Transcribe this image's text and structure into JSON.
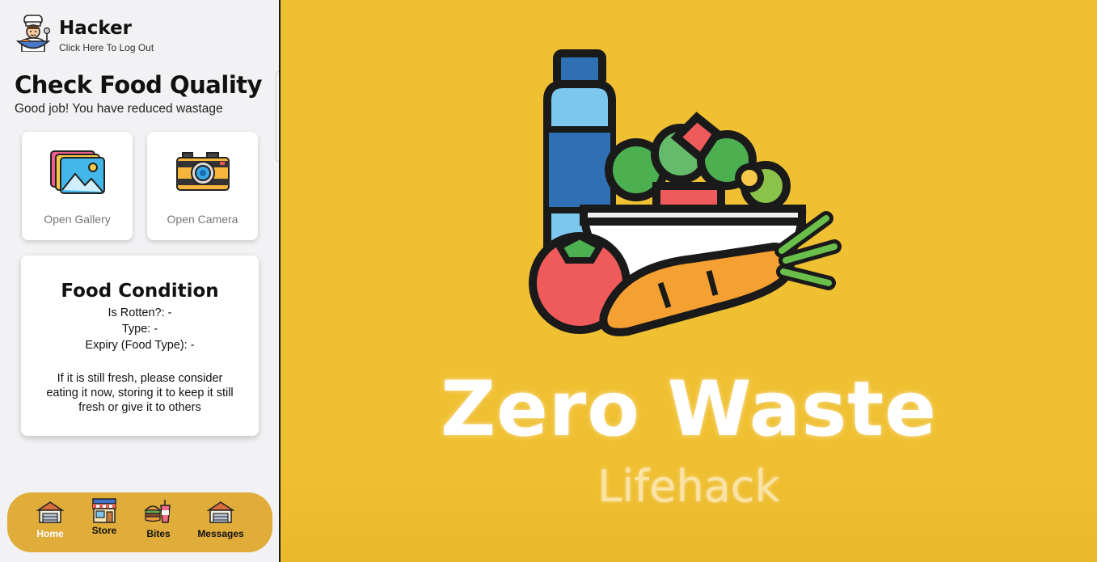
{
  "header": {
    "user_name": "Hacker",
    "logout_label": "Click Here To Log Out",
    "avatar_icon": "chef-avatar-icon"
  },
  "page": {
    "title": "Check Food Quality",
    "subtitle": "Good job! You have reduced wastage"
  },
  "actions": [
    {
      "label": "Open Gallery",
      "icon": "gallery-icon"
    },
    {
      "label": "Open Camera",
      "icon": "camera-icon"
    }
  ],
  "condition": {
    "title": "Food Condition",
    "rotten_label": "Is Rotten?:",
    "rotten_value": "-",
    "type_label": "Type:",
    "type_value": "-",
    "expiry_label": "Expiry (Food Type):",
    "expiry_value": "-",
    "note": "If it is still fresh, please consider eating it now, storing it to keep it still fresh or give it to others"
  },
  "nav": {
    "active": "Home",
    "items": [
      {
        "label": "Home",
        "icon": "home-icon"
      },
      {
        "label": "Store",
        "icon": "store-icon"
      },
      {
        "label": "Bites",
        "icon": "bites-icon"
      },
      {
        "label": "Messages",
        "icon": "messages-icon"
      }
    ]
  },
  "brand": {
    "title": "Zero Waste",
    "subtitle": "Lifehack",
    "illustration": "groceries-illustration"
  },
  "colors": {
    "nav_bg": "#e0ac3a",
    "brand_bg": "#f0c033",
    "panel_bg": "#f2f2f4"
  }
}
